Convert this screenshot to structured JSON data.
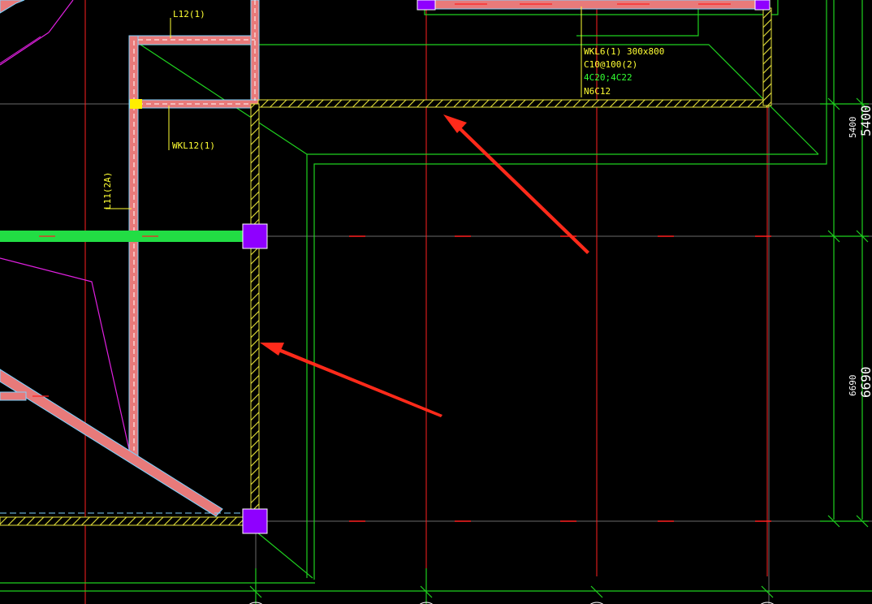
{
  "drawing": {
    "background": "#000000",
    "colors": {
      "beam_fill": "#e87a7a",
      "beam_edge": "#7fd3ff",
      "wall_hatch": "#e6e23a",
      "column": "#8f00ff",
      "column_edge": "#ffffff",
      "axis_line": "#ff2020",
      "green_line": "#1fd11f",
      "green_beam": "#22dd44",
      "magenta_line": "#e020e0",
      "yellow_text": "#ffff33",
      "green_text": "#33ff33",
      "white_text": "#ffffff",
      "arrow": "#ff2a1a"
    }
  },
  "labels": {
    "l12": "L12(1)",
    "wkl12": "WKL12(1)",
    "l11": "L11(2A)",
    "wkl6_name": "WKL6(1) 300x800",
    "wkl6_stirrup": "C10@100(2)",
    "wkl6_bars": "4C20;4C22",
    "wkl6_side": "N6C12"
  },
  "dimensions": {
    "upper_small": "5400",
    "upper_large": "5400",
    "lower_small": "6690",
    "lower_large": "6690"
  },
  "annotations": {
    "arrow_count": 2,
    "arrow_color": "#ff2a1a"
  }
}
